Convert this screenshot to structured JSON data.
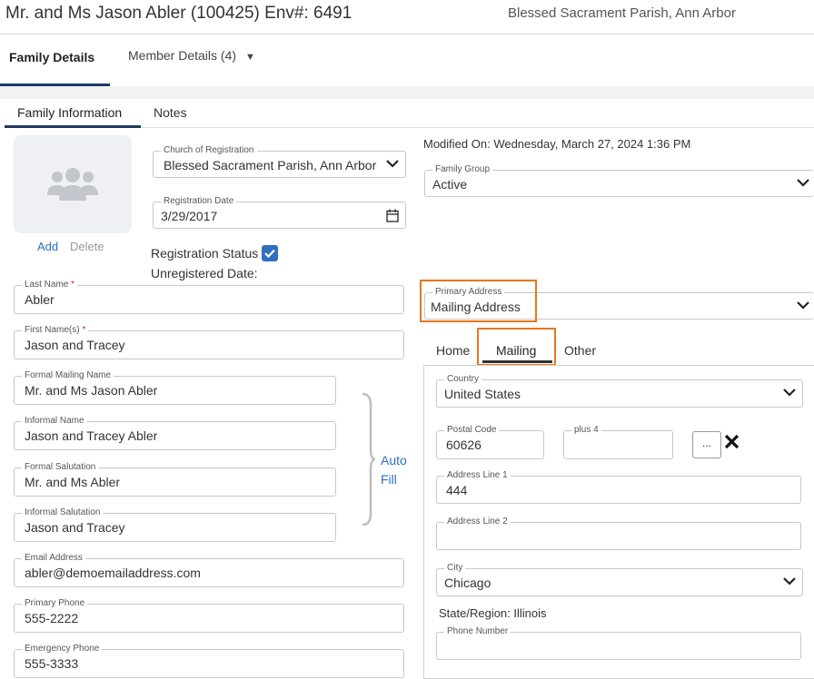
{
  "header": {
    "title": "Mr. and Ms Jason Abler (100425) Env#: 6491",
    "parish": "Blessed Sacrament Parish, Ann Arbor"
  },
  "top_tabs": {
    "family_details": "Family Details",
    "member_details": "Member Details (4)"
  },
  "sub_tabs": {
    "family_information": "Family Information",
    "notes": "Notes"
  },
  "photo": {
    "add": "Add",
    "delete": "Delete"
  },
  "registration": {
    "church_label": "Church of Registration",
    "church_value": "Blessed Sacrament Parish, Ann Arbor",
    "date_label": "Registration Date",
    "date_value": "3/29/2017",
    "status_label": "Registration Status",
    "unregistered_label": "Unregistered Date:"
  },
  "modified_on": "Modified On: Wednesday, March 27, 2024 1:36 PM",
  "family_group": {
    "label": "Family Group",
    "value": "Active"
  },
  "names": {
    "last_name_label": "Last Name",
    "last_name_value": "Abler",
    "first_name_label": "First Name(s)",
    "first_name_value": "Jason and Tracey",
    "required_mark": "*",
    "formal_mailing_label": "Formal Mailing Name",
    "formal_mailing_value": "Mr. and Ms Jason Abler",
    "informal_name_label": "Informal Name",
    "informal_name_value": "Jason and Tracey Abler",
    "formal_salutation_label": "Formal Salutation",
    "formal_salutation_value": "Mr. and Ms Abler",
    "informal_salutation_label": "Informal Salutation",
    "informal_salutation_value": "Jason and Tracey"
  },
  "auto_fill": {
    "line1": "Auto",
    "line2": "Fill"
  },
  "contact": {
    "email_label": "Email Address",
    "email_value": "abler@demoemailaddress.com",
    "primary_phone_label": "Primary Phone",
    "primary_phone_value": "555-2222",
    "emergency_phone_label": "Emergency Phone",
    "emergency_phone_value": "555-3333"
  },
  "primary_address": {
    "label": "Primary Address",
    "value": "Mailing Address"
  },
  "address_tabs": {
    "home": "Home",
    "mailing": "Mailing",
    "other": "Other"
  },
  "address": {
    "country_label": "Country",
    "country_value": "United States",
    "postal_label": "Postal Code",
    "postal_value": "60626",
    "plus4_label": "plus 4",
    "plus4_value": "",
    "lookup_button": "...",
    "line1_label": "Address Line 1",
    "line1_value": "444",
    "line2_label": "Address Line 2",
    "line2_value": "",
    "city_label": "City",
    "city_value": "Chicago",
    "state_region": "State/Region: Illinois",
    "phone_label": "Phone Number",
    "phone_value": ""
  },
  "colors": {
    "accent": "#1f3a60",
    "link": "#2f6fbf",
    "highlight": "#e8761f"
  }
}
